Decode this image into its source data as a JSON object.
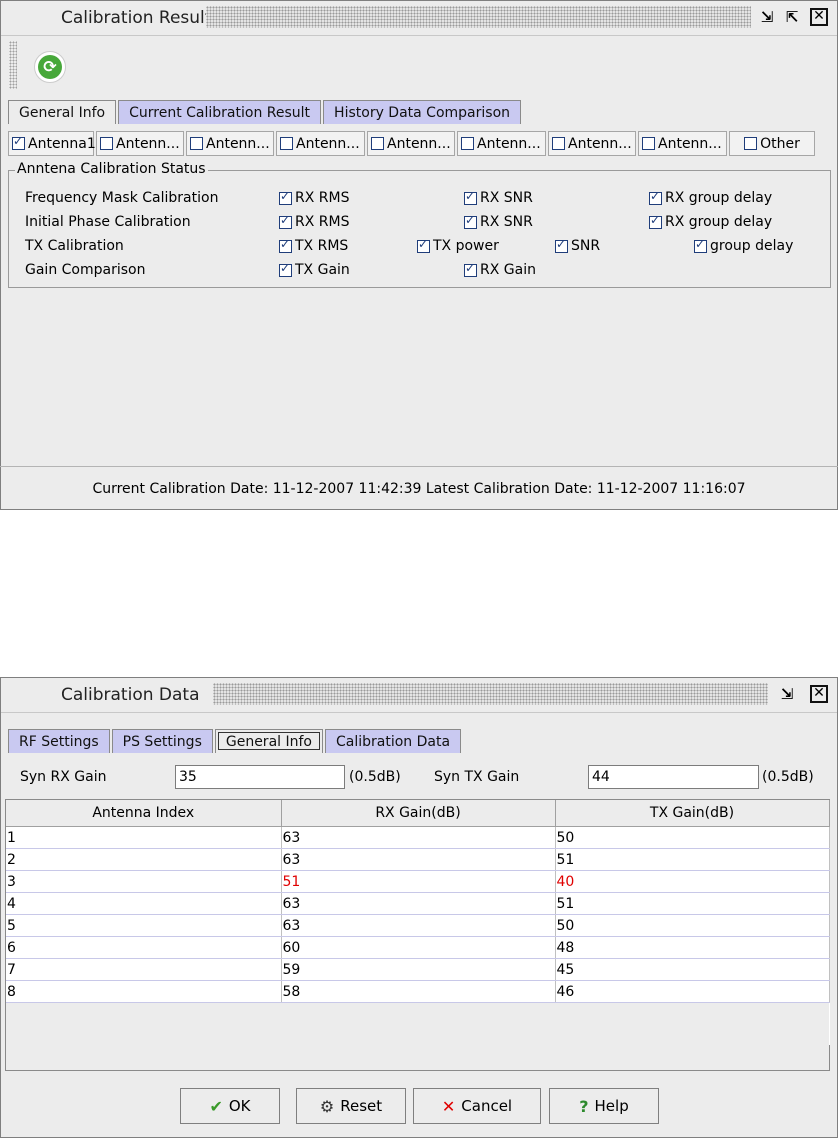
{
  "win1": {
    "title": "Calibration Result",
    "tabs": [
      "General Info",
      "Current Calibration Result",
      "History Data Comparison"
    ],
    "antennas": [
      {
        "label": "Antenna1",
        "checked": true
      },
      {
        "label": "Antenn...",
        "checked": false
      },
      {
        "label": "Antenn...",
        "checked": false
      },
      {
        "label": "Antenn...",
        "checked": false
      },
      {
        "label": "Antenn...",
        "checked": false
      },
      {
        "label": "Antenn...",
        "checked": false
      },
      {
        "label": "Antenn...",
        "checked": false
      },
      {
        "label": "Antenn...",
        "checked": false
      },
      {
        "label": "Other",
        "checked": false
      }
    ],
    "group_title": "Anntena Calibration Status",
    "rows": [
      {
        "label": "Frequency Mask Calibration",
        "items": [
          "RX RMS",
          "RX SNR",
          "RX group delay"
        ]
      },
      {
        "label": "Initial Phase Calibration",
        "items": [
          "RX RMS",
          "RX SNR",
          "RX group delay"
        ]
      },
      {
        "label": "TX Calibration",
        "items": [
          "TX RMS",
          "TX power",
          "SNR",
          "group delay"
        ]
      },
      {
        "label": "Gain Comparison",
        "items": [
          "TX Gain",
          "RX Gain"
        ]
      }
    ],
    "status_text": "Current Calibration Date: 11-12-2007 11:42:39  Latest Calibration Date: 11-12-2007 11:16:07"
  },
  "win2": {
    "title": "Calibration Data",
    "tabs": [
      "RF Settings",
      "PS Settings",
      "General Info",
      "Calibration Data"
    ],
    "syn_rx_label": "Syn RX Gain",
    "syn_rx_value": "35",
    "syn_rx_unit": "(0.5dB)",
    "syn_tx_label": "Syn TX Gain",
    "syn_tx_value": "44",
    "syn_tx_unit": "(0.5dB)",
    "columns": [
      "Antenna Index",
      "RX Gain(dB)",
      "TX Gain(dB)"
    ],
    "rows": [
      [
        "1",
        "63",
        "50"
      ],
      [
        "2",
        "63",
        "51"
      ],
      [
        "3",
        "51",
        "40"
      ],
      [
        "4",
        "63",
        "51"
      ],
      [
        "5",
        "63",
        "50"
      ],
      [
        "6",
        "60",
        "48"
      ],
      [
        "7",
        "59",
        "45"
      ],
      [
        "8",
        "58",
        "46"
      ]
    ],
    "highlight_row": 3,
    "highlight_color": "#e00000",
    "buttons": [
      "OK",
      "Reset",
      "Cancel",
      "Help"
    ]
  }
}
